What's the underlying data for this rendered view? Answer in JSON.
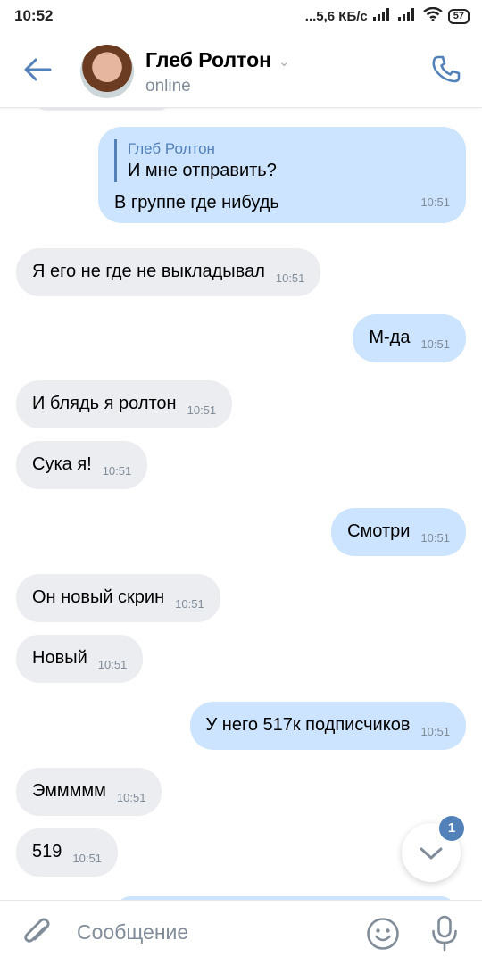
{
  "status_bar": {
    "time": "10:52",
    "network": "...5,6 КБ/с",
    "battery": "57"
  },
  "header": {
    "name": "Глеб Ролтон",
    "status": "online"
  },
  "messages": [
    {
      "dir": "out",
      "reply_author": "Глеб Ролтон",
      "reply_text": "И мне отправить?",
      "text": "В группе где нибудь",
      "time": "10:51"
    },
    {
      "dir": "in",
      "text": "Я его не где не выкладывал",
      "time": "10:51"
    },
    {
      "dir": "out",
      "text": "М-да",
      "time": "10:51"
    },
    {
      "dir": "in",
      "text": "И блядь я ролтон",
      "time": "10:51"
    },
    {
      "dir": "in",
      "text": "Сука я!",
      "time": "10:51"
    },
    {
      "dir": "out",
      "text": "Смотри",
      "time": "10:51"
    },
    {
      "dir": "in",
      "text": "Он новый скрин",
      "time": "10:51"
    },
    {
      "dir": "in",
      "text": "Новый",
      "time": "10:51"
    },
    {
      "dir": "out",
      "text": "У него 517к подписчиков",
      "time": "10:51"
    },
    {
      "dir": "in",
      "text": "Эммммм",
      "time": "10:51"
    },
    {
      "dir": "in",
      "text": "519",
      "time": "10:51"
    }
  ],
  "unread_count": "1",
  "composer": {
    "placeholder": "Сообщение"
  },
  "icons": {
    "back": "arrow-left-icon",
    "call": "phone-icon",
    "attach": "paperclip-icon",
    "emoji": "smile-icon",
    "mic": "microphone-icon",
    "scroll": "chevron-down-icon"
  },
  "colors": {
    "accent": "#5181b8",
    "incoming": "#ebedf0",
    "outgoing": "#cce4ff"
  }
}
